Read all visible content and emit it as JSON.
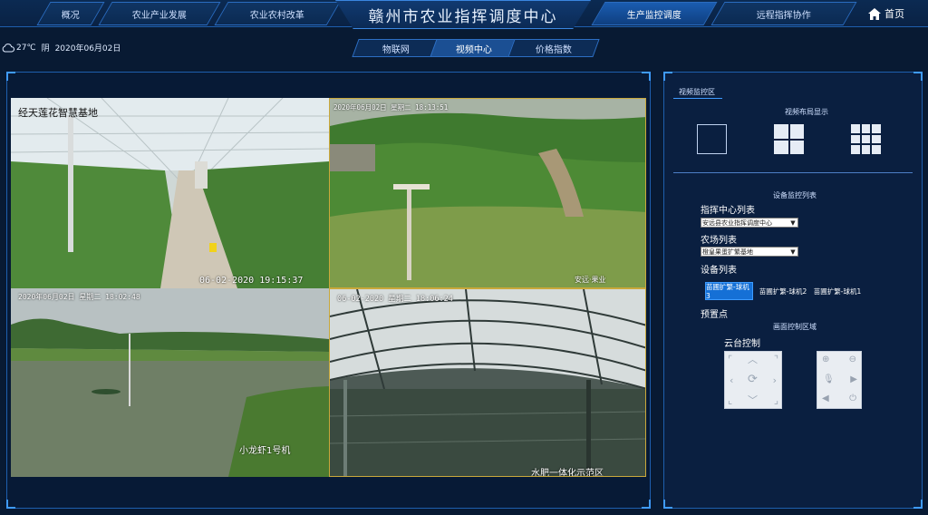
{
  "nav": {
    "tabs": [
      {
        "label": "概况"
      },
      {
        "label": "农业产业发展"
      },
      {
        "label": "农业农村改革"
      },
      {
        "label": "生产监控调度"
      },
      {
        "label": "远程指挥协作"
      }
    ],
    "title": "赣州市农业指挥调度中心",
    "home_label": "首页"
  },
  "weather": {
    "icon": "cloud-icon",
    "temperature": "27℃",
    "condition": "阴",
    "date": "2020年06月02日"
  },
  "subtabs": [
    {
      "label": "物联网"
    },
    {
      "label": "视频中心"
    },
    {
      "label": "价格指数"
    }
  ],
  "videos": [
    {
      "overlay": "经天莲花智慧基地",
      "timestamp": "06-02-2020 19:15:37",
      "caption": ""
    },
    {
      "overlay": "2020年06月02日 星期二 18:13:51",
      "timestamp": "",
      "caption": "安远·果业"
    },
    {
      "overlay": "2020年06月02日 星期二 18:02:48",
      "timestamp": "",
      "caption": "小龙虾1号机"
    },
    {
      "overlay": "06-02-2020 星期二 18:06:24",
      "timestamp": "",
      "caption": "水肥一体化示范区"
    }
  ],
  "control": {
    "section_title": "视频监控区",
    "layout_title": "视频布局显示",
    "device_monitor_title": "设备监控列表",
    "command_center_label": "指挥中心列表",
    "command_center_value": "安远县农业指挥调度中心",
    "farm_label": "农场列表",
    "farm_value": "橙皇果蛋扩繁基地",
    "device_label": "设备列表",
    "devices": [
      {
        "label": "苗圃扩繁-球机3"
      },
      {
        "label": "苗圃扩繁-球机2"
      },
      {
        "label": "苗圃扩繁-球机1"
      }
    ],
    "preset_label": "预置点",
    "screen_area_label": "画面控制区域",
    "ptz_label": "云台控制"
  },
  "colors": {
    "background": "#081a33",
    "accent": "#1570d6",
    "border": "#1e5fae"
  }
}
